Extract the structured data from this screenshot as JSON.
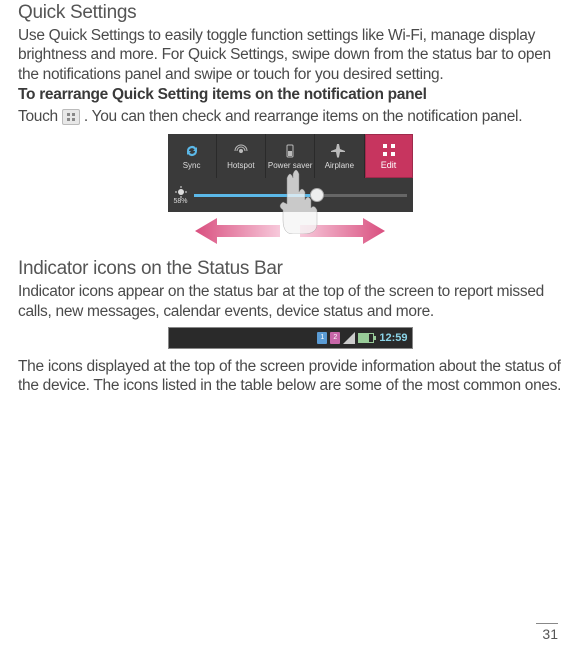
{
  "section1": {
    "heading": "Quick Settings",
    "para1": "Use Quick Settings to easily toggle function settings like Wi-Fi, manage display brightness and more. For Quick Settings, swipe down from the status bar to open the notifications panel and swipe or touch for you desired setting.",
    "bold": "To rearrange Quick Setting items on the notification panel",
    "touch_before": "Touch",
    "touch_after": ". You can then check and rearrange items on the notification panel."
  },
  "quick_panel": {
    "items": [
      {
        "label": "Sync",
        "icon": "sync"
      },
      {
        "label": "Hotspot",
        "icon": "hotspot"
      },
      {
        "label": "Power saver",
        "icon": "power"
      },
      {
        "label": "Airplane",
        "icon": "airplane"
      }
    ],
    "edit_label": "Edit",
    "brightness": "58%"
  },
  "section2": {
    "heading": "Indicator icons on the Status Bar",
    "para1": "Indicator icons appear on the status bar at the top of the screen to report missed calls, new messages, calendar events, device status and more.",
    "para2": "The icons displayed at the top of the screen provide information about the status of the device. The icons listed in the table below are some of the most common ones."
  },
  "statusbar": {
    "sim1": "1",
    "sim2": "2",
    "time": "12:59"
  },
  "page_number": "31"
}
